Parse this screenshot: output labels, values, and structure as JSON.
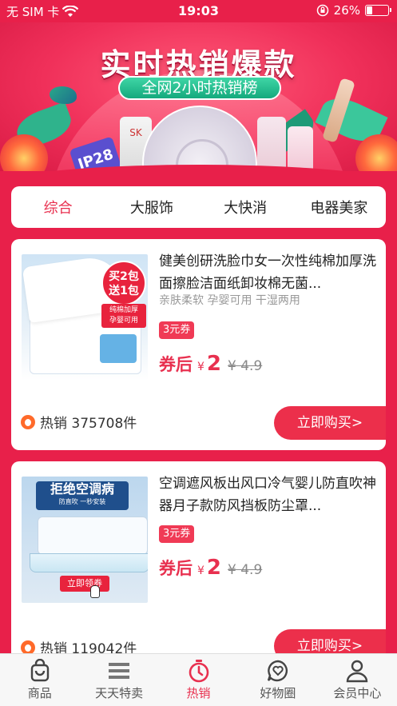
{
  "status_bar": {
    "carrier": "无 SIM 卡",
    "time": "19:03",
    "battery": "26%",
    "battery_level": 0.26
  },
  "banner": {
    "title": "实时热销爆款",
    "subtitle": "全网2小时热销榜",
    "brand_text_1": "IP28",
    "brand_text_2": "SK"
  },
  "tabs": [
    {
      "label": "综合",
      "active": true
    },
    {
      "label": "大服饰",
      "active": false
    },
    {
      "label": "大快消",
      "active": false
    },
    {
      "label": "电器美家",
      "active": false
    }
  ],
  "products": [
    {
      "title": "健美创研洗脸巾女一次性纯棉加厚洗面擦脸洁面纸卸妆棉无菌...",
      "tags": "亲肤柔软 孕婴可用 干湿两用",
      "coupon": "3元券",
      "price_label": "券后",
      "currency": "¥",
      "price": "2",
      "original_price": "¥ 4.9",
      "sales_text": "热销 375708件",
      "buy_label": "立即购买>",
      "thumb": {
        "badge_line1": "买2包",
        "badge_line2": "送1包",
        "note_line1": "纯棉加厚",
        "note_line2": "孕婴可用"
      }
    },
    {
      "title": "空调遮风板出风口冷气婴儿防直吹神器月子款防风挡板防尘罩...",
      "tags": "",
      "coupon": "3元券",
      "price_label": "券后",
      "currency": "¥",
      "price": "2",
      "original_price": "¥ 4.9",
      "sales_text": "热销 119042件",
      "buy_label": "立即购买>",
      "thumb": {
        "headline": "拒绝空调病",
        "subline": "防直吹 一秒安装",
        "button": "立即领券"
      }
    }
  ],
  "bottom_nav": [
    {
      "label": "商品",
      "icon": "bag-icon",
      "active": false
    },
    {
      "label": "天天特卖",
      "icon": "list-icon",
      "active": false
    },
    {
      "label": "热销",
      "icon": "stopwatch-icon",
      "active": true
    },
    {
      "label": "好物圈",
      "icon": "heart-chat-icon",
      "active": false
    },
    {
      "label": "会员中心",
      "icon": "user-icon",
      "active": false
    }
  ],
  "colors": {
    "brand_red": "#e8204a",
    "accent_red": "#e8304f",
    "banner_green": "#14a97d"
  }
}
